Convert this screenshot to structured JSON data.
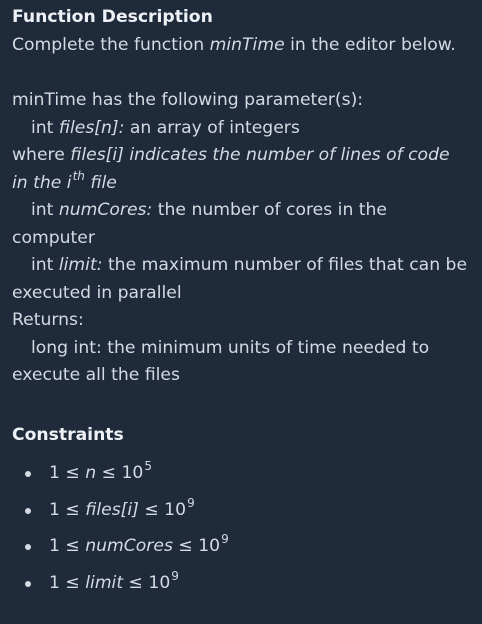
{
  "heading": "Function Description",
  "intro": {
    "prefix": "Complete the function ",
    "function_name": "minTime",
    "suffix": " in the editor below."
  },
  "params_intro": "minTime has the following parameter(s):",
  "param_files": {
    "type": "int ",
    "name": "files[n]",
    "colon": ":",
    "desc": "  an array of integers"
  },
  "param_files_where": {
    "prefix": "where ",
    "italic_line1": "files[i] indicates the number of lines of code",
    "italic_line2_a": "in the i",
    "italic_sup": "th",
    "italic_line2_b": " file"
  },
  "param_cores": {
    "type": "int ",
    "name": "numCores:",
    "desc_line1": " the number of cores in the",
    "desc_line2": "computer"
  },
  "param_limit": {
    "type": "int ",
    "name": "limit",
    "colon": ":",
    "desc_line1": " the maximum number of files that can be",
    "desc_line2": "executed in parallel"
  },
  "returns_label": "Returns:",
  "returns": {
    "line1": "long int: the minimum units of time needed to",
    "line2": "execute all the files"
  },
  "constraints_heading": "Constraints",
  "constraints": [
    {
      "pre": "1 ≤ ",
      "var": "n",
      "post": " ≤ 10",
      "exp": "5"
    },
    {
      "pre": "1 ≤ ",
      "var": "files[i]",
      "post": " ≤ 10",
      "exp": "9"
    },
    {
      "pre": "1 ≤ ",
      "var": "numCores",
      "post": " ≤ 10",
      "exp": "9"
    },
    {
      "pre": "1 ≤ ",
      "var": "limit",
      "post": " ≤ 10",
      "exp": "9"
    }
  ]
}
